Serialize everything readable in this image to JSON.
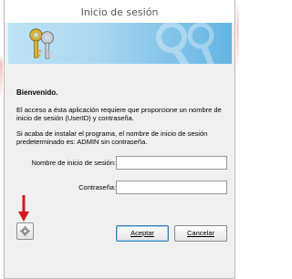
{
  "window": {
    "title": "Inicio de sesión"
  },
  "banner": {
    "keys_icon": "keys-icon",
    "watermark_icon": "keys-watermark-icon"
  },
  "content": {
    "welcome": "Bienvenido.",
    "paragraph1": "El acceso a ésta aplicación requiere que proporcione un nombre de inicio de sesión (UserID) y contraseña.",
    "paragraph2": "Si acaba de instalar el programa, el nombre de inicio de sesión predeterminado es: ADMIN sin contraseña."
  },
  "form": {
    "username_label": "Nombre de inicio de sesión:",
    "username_value": "",
    "password_label": "Contraseña:",
    "password_value": ""
  },
  "buttons": {
    "settings_icon": "gear-icon",
    "accept_label": "Aceptar",
    "cancel_label": "Cancelar"
  },
  "colors": {
    "banner_light": "#bfe3f6",
    "banner_dark": "#63b4e3",
    "arrow": "#d81818"
  }
}
